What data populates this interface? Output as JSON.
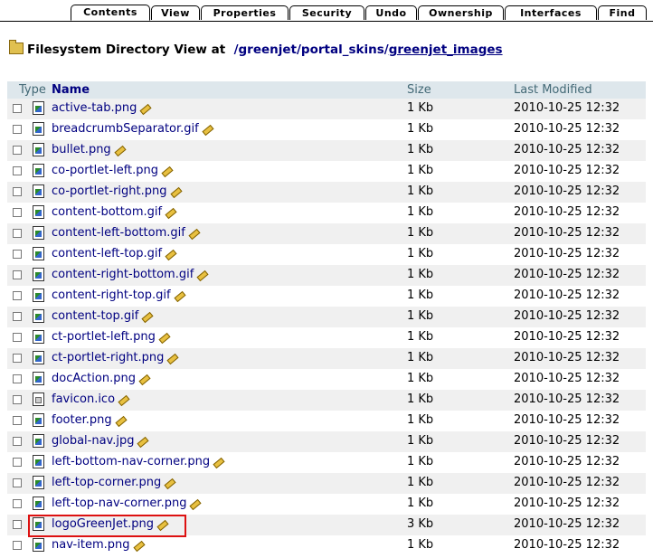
{
  "tabs": [
    {
      "label": "Contents",
      "active": true
    },
    {
      "label": "View"
    },
    {
      "label": "Properties"
    },
    {
      "label": "Security"
    },
    {
      "label": "Undo"
    },
    {
      "label": "Ownership"
    },
    {
      "label": "Interfaces"
    },
    {
      "label": "Find"
    }
  ],
  "header": {
    "title_prefix": "Filesystem Directory View at",
    "path": [
      "/greenjet",
      "/",
      "portal_skins",
      "/",
      "greenjet_images"
    ]
  },
  "columns": {
    "type": "Type",
    "name": "Name",
    "size": "Size",
    "modified": "Last Modified"
  },
  "files": [
    {
      "name": "active-tab.png",
      "size": "1 Kb",
      "modified": "2010-10-25 12:32",
      "icon": "image-icon"
    },
    {
      "name": "breadcrumbSeparator.gif",
      "size": "1 Kb",
      "modified": "2010-10-25 12:32",
      "icon": "image-icon"
    },
    {
      "name": "bullet.png",
      "size": "1 Kb",
      "modified": "2010-10-25 12:32",
      "icon": "image-icon"
    },
    {
      "name": "co-portlet-left.png",
      "size": "1 Kb",
      "modified": "2010-10-25 12:32",
      "icon": "image-icon"
    },
    {
      "name": "co-portlet-right.png",
      "size": "1 Kb",
      "modified": "2010-10-25 12:32",
      "icon": "image-icon"
    },
    {
      "name": "content-bottom.gif",
      "size": "1 Kb",
      "modified": "2010-10-25 12:32",
      "icon": "image-icon"
    },
    {
      "name": "content-left-bottom.gif",
      "size": "1 Kb",
      "modified": "2010-10-25 12:32",
      "icon": "image-icon"
    },
    {
      "name": "content-left-top.gif",
      "size": "1 Kb",
      "modified": "2010-10-25 12:32",
      "icon": "image-icon"
    },
    {
      "name": "content-right-bottom.gif",
      "size": "1 Kb",
      "modified": "2010-10-25 12:32",
      "icon": "image-icon"
    },
    {
      "name": "content-right-top.gif",
      "size": "1 Kb",
      "modified": "2010-10-25 12:32",
      "icon": "image-icon"
    },
    {
      "name": "content-top.gif",
      "size": "1 Kb",
      "modified": "2010-10-25 12:32",
      "icon": "image-icon"
    },
    {
      "name": "ct-portlet-left.png",
      "size": "1 Kb",
      "modified": "2010-10-25 12:32",
      "icon": "image-icon"
    },
    {
      "name": "ct-portlet-right.png",
      "size": "1 Kb",
      "modified": "2010-10-25 12:32",
      "icon": "image-icon"
    },
    {
      "name": "docAction.png",
      "size": "1 Kb",
      "modified": "2010-10-25 12:32",
      "icon": "image-icon"
    },
    {
      "name": "favicon.ico",
      "size": "1 Kb",
      "modified": "2010-10-25 12:32",
      "icon": "file-icon"
    },
    {
      "name": "footer.png",
      "size": "1 Kb",
      "modified": "2010-10-25 12:32",
      "icon": "image-icon"
    },
    {
      "name": "global-nav.jpg",
      "size": "1 Kb",
      "modified": "2010-10-25 12:32",
      "icon": "image-icon"
    },
    {
      "name": "left-bottom-nav-corner.png",
      "size": "1 Kb",
      "modified": "2010-10-25 12:32",
      "icon": "image-icon"
    },
    {
      "name": "left-top-corner.png",
      "size": "1 Kb",
      "modified": "2010-10-25 12:32",
      "icon": "image-icon"
    },
    {
      "name": "left-top-nav-corner.png",
      "size": "1 Kb",
      "modified": "2010-10-25 12:32",
      "icon": "image-icon"
    },
    {
      "name": "logoGreenJet.png",
      "size": "3 Kb",
      "modified": "2010-10-25 12:32",
      "icon": "image-icon",
      "highlighted": true
    },
    {
      "name": "nav-item.png",
      "size": "1 Kb",
      "modified": "2010-10-25 12:32",
      "icon": "image-icon"
    }
  ],
  "colors": {
    "link": "#000080",
    "header_bg": "#dee7ec",
    "row_alt": "#f0f0f0",
    "highlight": "#dd1111"
  }
}
